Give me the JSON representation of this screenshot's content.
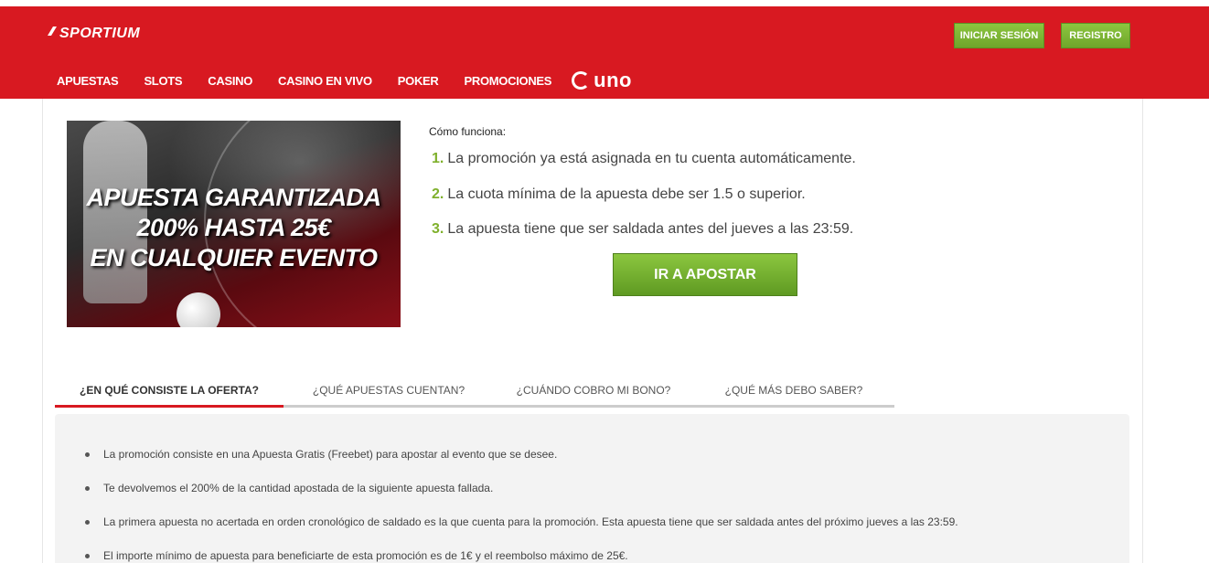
{
  "header": {
    "logo_text": "SPORTIUM",
    "login_label": "INICIAR SESIÓN",
    "register_label": "REGISTRO",
    "nav": [
      "APUESTAS",
      "SLOTS",
      "CASINO",
      "CASINO EN VIVO",
      "POKER",
      "PROMOCIONES"
    ],
    "uno_label": "uno",
    "brand_color": "#d81921",
    "accent_color": "#7fb02c"
  },
  "banner": {
    "line1": "APUESTA GARANTIZADA",
    "line2": "200% HASTA 25€",
    "line3": "EN CUALQUIER EVENTO"
  },
  "how": {
    "title": "Cómo funciona:",
    "steps": [
      {
        "num": "1.",
        "text": "La promoción ya está asignada en tu cuenta automáticamente."
      },
      {
        "num": "2.",
        "text": "La cuota mínima de la apuesta debe ser 1.5 o superior."
      },
      {
        "num": "3.",
        "text": "La apuesta tiene que ser saldada antes del jueves a las 23:59."
      }
    ],
    "cta_label": "IR A APOSTAR"
  },
  "tabs": [
    {
      "label": "¿EN QUÉ CONSISTE LA OFERTA?",
      "active": true
    },
    {
      "label": "¿QUÉ APUESTAS CUENTAN?",
      "active": false
    },
    {
      "label": "¿CUÁNDO COBRO MI BONO?",
      "active": false
    },
    {
      "label": "¿QUÉ MÁS DEBO SABER?",
      "active": false
    }
  ],
  "offer_bullets": [
    "La promoción consiste en una Apuesta Gratis (Freebet) para apostar al evento que se desee.",
    "Te devolvemos el 200% de la cantidad apostada de la siguiente apuesta fallada.",
    "La primera apuesta no acertada en orden cronológico de saldado es la que cuenta para la promoción. Esta apuesta tiene que ser saldada antes del próximo jueves a las 23:59.",
    "El importe mínimo de apuesta para beneficiarte de esta promoción es de 1€ y el reembolso máximo de 25€."
  ]
}
